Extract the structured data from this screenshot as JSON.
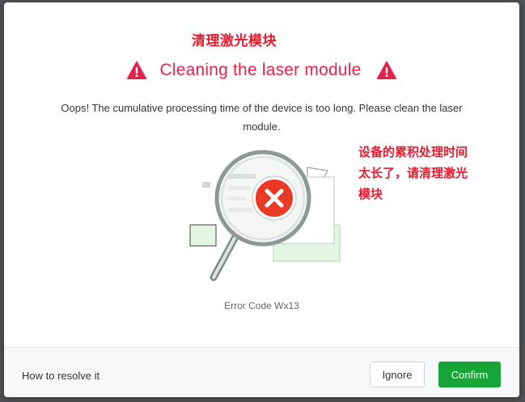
{
  "annotations": {
    "title_cn": "清理激光模块",
    "side_cn_lines": [
      "设备的累积处理时间",
      "太长了，请清理激光",
      "模块"
    ]
  },
  "dialog": {
    "title": "Cleaning the laser module",
    "message": "Oops! The cumulative processing time of the device is too long. Please clean the laser module.",
    "error_code": "Error Code Wx13"
  },
  "footer": {
    "help_link": "How to resolve it",
    "ignore_label": "Ignore",
    "confirm_label": "Confirm"
  },
  "colors": {
    "title": "#e5224a",
    "annotation": "#e8192c",
    "confirm_bg": "#16a536",
    "error_badge": "#ea3a26"
  },
  "icons": {
    "warning": "warning-triangle-icon",
    "illustration": "magnifier-error-illustration",
    "error_badge": "close-circle-icon"
  }
}
